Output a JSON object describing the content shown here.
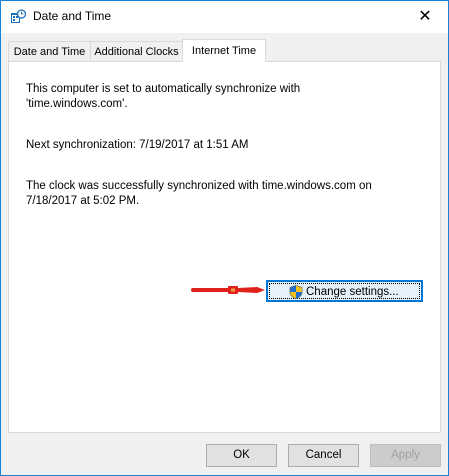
{
  "window": {
    "title": "Date and Time",
    "close_glyph": "✕"
  },
  "tabs": [
    {
      "label": "Date and Time"
    },
    {
      "label": "Additional Clocks"
    },
    {
      "label": "Internet Time",
      "active": true
    }
  ],
  "content": {
    "line1": "This computer is set to automatically synchronize with",
    "line2": "'time.windows.com'.",
    "next_sync": "Next synchronization: 7/19/2017 at 1:51 AM",
    "status_line1": "The clock was successfully synchronized with time.windows.com on",
    "status_line2": "7/18/2017 at 5:02 PM."
  },
  "change_settings_label": "Change settings...",
  "buttons": {
    "ok": "OK",
    "cancel": "Cancel",
    "apply": "Apply"
  },
  "colors": {
    "accent": "#0078d7",
    "arrow": "#e0201b"
  }
}
